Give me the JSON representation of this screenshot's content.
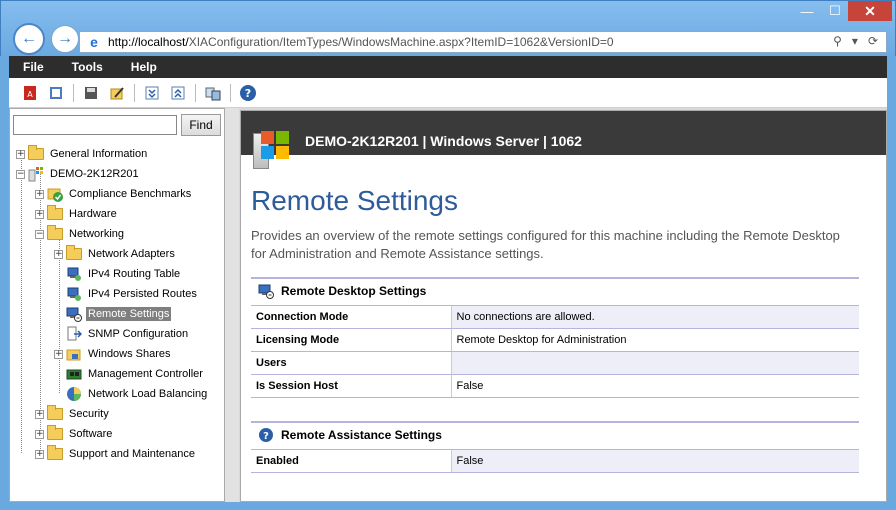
{
  "browser": {
    "url_host": "http://localhost/",
    "url_rest": "XIAConfiguration/ItemTypes/WindowsMachine.aspx?ItemID=1062&VersionID=0"
  },
  "menu": [
    "File",
    "Tools",
    "Help"
  ],
  "search": {
    "button": "Find",
    "value": ""
  },
  "tree": {
    "general": "General Information",
    "machine": "DEMO-2K12R201",
    "compliance": "Compliance Benchmarks",
    "hardware": "Hardware",
    "networking": "Networking",
    "adapters": "Network Adapters",
    "ipv4_routing": "IPv4 Routing Table",
    "ipv4_persisted": "IPv4 Persisted Routes",
    "remote": "Remote Settings",
    "snmp": "SNMP Configuration",
    "shares": "Windows Shares",
    "mgmt": "Management Controller",
    "nlb": "Network Load Balancing",
    "security": "Security",
    "software": "Software",
    "support": "Support and Maintenance"
  },
  "header": {
    "title": "DEMO-2K12R201 | Windows Server | 1062"
  },
  "page": {
    "title": "Remote Settings",
    "description": "Provides an overview of the remote settings configured for this machine including the Remote Desktop for Administration and Remote Assistance settings."
  },
  "rds": {
    "title": "Remote Desktop Settings",
    "rows": [
      {
        "k": "Connection Mode",
        "v": "No connections are allowed."
      },
      {
        "k": "Licensing Mode",
        "v": "Remote Desktop for Administration"
      },
      {
        "k": "Users",
        "v": ""
      },
      {
        "k": "Is Session Host",
        "v": "False"
      }
    ]
  },
  "ras": {
    "title": "Remote Assistance Settings",
    "rows": [
      {
        "k": "Enabled",
        "v": "False"
      }
    ]
  },
  "colors": {
    "menubar": "#2d2d2d",
    "title": "#2e5b9a",
    "close": "#c7443a"
  }
}
